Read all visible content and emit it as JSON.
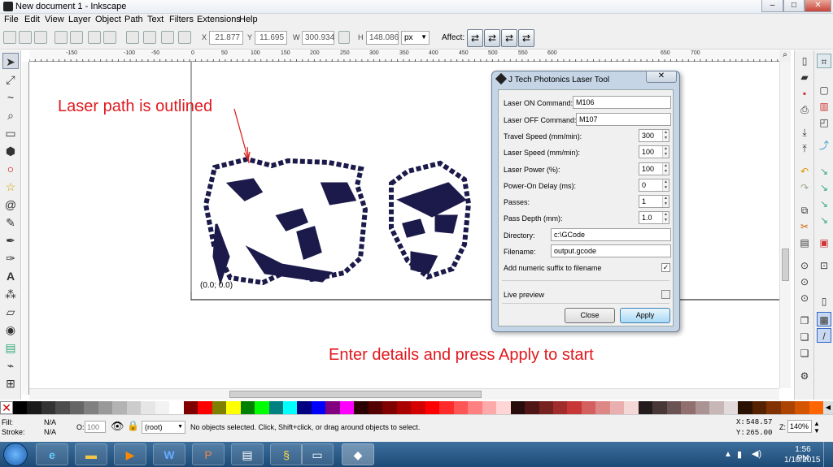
{
  "window": {
    "title": "New document 1 - Inkscape",
    "minimize": "–",
    "maximize": "□",
    "close": "✕"
  },
  "menu": [
    "File",
    "Edit",
    "View",
    "Layer",
    "Object",
    "Path",
    "Text",
    "Filters",
    "Extensions",
    "Help"
  ],
  "toolbar": {
    "x_label": "X",
    "x_value": "21.877",
    "y_label": "Y",
    "y_value": "11.695",
    "w_label": "W",
    "w_value": "300.934",
    "h_label": "H",
    "h_value": "148.086",
    "unit": "px",
    "affect_label": "Affect:"
  },
  "ruler": {
    "ticks": [
      "-150",
      "-100",
      "-50",
      "0",
      "50",
      "100",
      "150",
      "200",
      "250",
      "300",
      "350",
      "400",
      "450",
      "500",
      "550",
      "600",
      "650",
      "700"
    ]
  },
  "canvas": {
    "origin_label": "(0.0; 0.0)",
    "annotation_top": "Laser path is outlined",
    "annotation_bottom": "Enter details and press Apply to start"
  },
  "dialog": {
    "title": "J Tech Photonics Laser Tool",
    "close": "✕",
    "fields": {
      "laser_on_label": "Laser ON Command:",
      "laser_on_value": "M106",
      "laser_off_label": "Laser OFF Command:",
      "laser_off_value": "M107",
      "travel_label": "Travel Speed (mm/min):",
      "travel_value": "300",
      "laser_speed_label": "Laser Speed (mm/min):",
      "laser_speed_value": "100",
      "power_label": "Laser Power (%):",
      "power_value": "100",
      "delay_label": "Power-On Delay (ms):",
      "delay_value": "0",
      "passes_label": "Passes:",
      "passes_value": "1",
      "depth_label": "Pass Depth (mm):",
      "depth_value": "1.0",
      "directory_label": "Directory:",
      "directory_value": "c:\\GCode",
      "filename_label": "Filename:",
      "filename_value": "output.gcode",
      "suffix_label": "Add numeric suffix to filename",
      "suffix_checked": true,
      "live_label": "Live preview",
      "live_checked": false
    },
    "close_button": "Close",
    "apply_button": "Apply"
  },
  "palette_colors": [
    "#000000",
    "#1a1a1a",
    "#333333",
    "#4d4d4d",
    "#666666",
    "#808080",
    "#999999",
    "#b3b3b3",
    "#cccccc",
    "#e6e6e6",
    "#f2f2f2",
    "#ffffff",
    "#800000",
    "#ff0000",
    "#808000",
    "#ffff00",
    "#008000",
    "#00ff00",
    "#008080",
    "#00ffff",
    "#000080",
    "#0000ff",
    "#800080",
    "#ff00ff",
    "#2b0000",
    "#550000",
    "#800000",
    "#aa0000",
    "#d40000",
    "#ff0000",
    "#ff2a2a",
    "#ff5555",
    "#ff8080",
    "#ffaaaa",
    "#ffd5d5",
    "#280b0b",
    "#501616",
    "#782121",
    "#a02c2c",
    "#c83737",
    "#d35f5f",
    "#de8787",
    "#e9afaf",
    "#f4d7d7",
    "#241c1c",
    "#483737",
    "#6c5353",
    "#916f6f",
    "#ac9393",
    "#c8b7b7",
    "#e3dbdb",
    "#2b1100",
    "#552200",
    "#803300",
    "#aa4400",
    "#d45500",
    "#ff6600"
  ],
  "status": {
    "fill_label": "Fill:",
    "fill_value": "N/A",
    "stroke_label": "Stroke:",
    "stroke_value": "N/A",
    "opacity_label": "O:",
    "opacity_value": "100",
    "layer": "(root)",
    "message": "No objects selected. Click, Shift+click, or drag around objects to select.",
    "x_label": "X:",
    "x_value": "548.57",
    "y_label": "Y:",
    "y_value": "265.00",
    "zoom_label": "Z:",
    "zoom_value": "140%"
  },
  "taskbar": {
    "time": "1:56 PM",
    "date": "1/10/2015"
  }
}
